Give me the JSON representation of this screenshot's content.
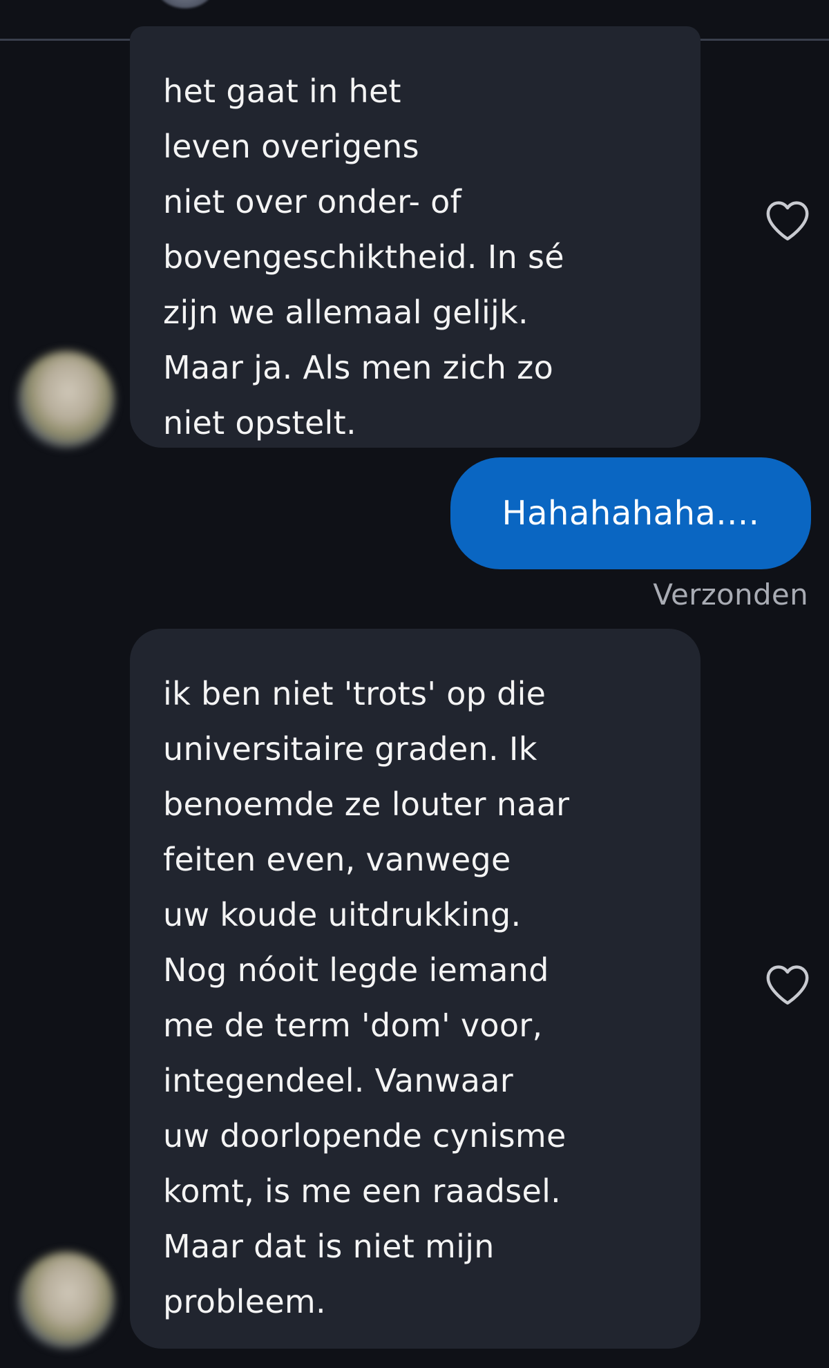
{
  "messages": [
    {
      "direction": "incoming",
      "text": "het gaat in het\nleven overigens\nniet over onder- of\nbovengeschiktheid. In sé\nzijn we allemaal gelijk.\nMaar ja. Als men zich zo\nniet opstelt.",
      "reaction_icon": "heart-outline-icon"
    },
    {
      "direction": "outgoing",
      "text": "Hahahahaha....",
      "status": "Verzonden"
    },
    {
      "direction": "incoming",
      "text": "ik ben niet 'trots' op die\nuniversitaire graden. Ik\nbenoemde ze louter naar\nfeiten even, vanwege\nuw koude uitdrukking.\nNog nóoit legde iemand\nme de term 'dom' voor,\nintegendeel. Vanwaar\nuw doorlopende cynisme\nkomt, is me een raadsel.\nMaar dat is niet mijn\nprobleem.",
      "reaction_icon": "heart-outline-icon"
    }
  ],
  "colors": {
    "background": "#0f1117",
    "incoming_bubble": "#21252f",
    "outgoing_bubble": "#0a66c2",
    "status_text": "#a9acb4"
  }
}
